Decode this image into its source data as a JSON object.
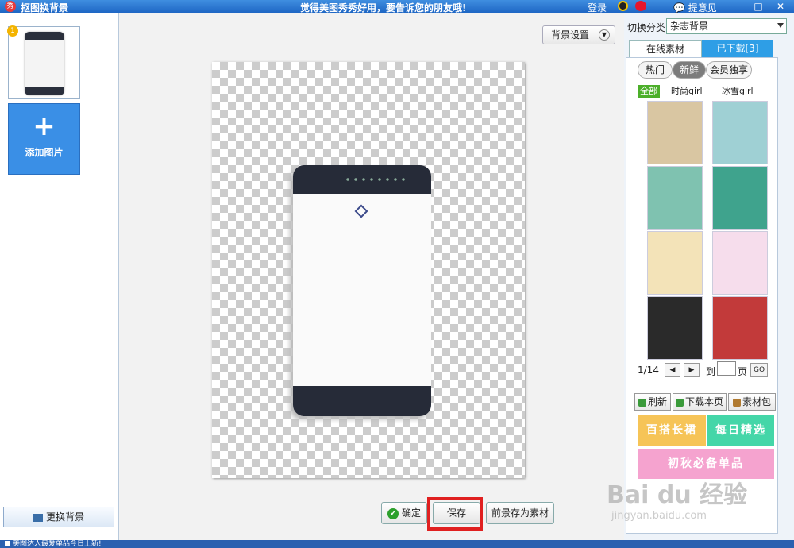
{
  "title_bar": {
    "app_logo": "秀",
    "app_title": "抠图换背景",
    "slogan": "觉得美图秀秀好用，要告诉您的朋友哦!",
    "login": "登录",
    "feedback": "提意见"
  },
  "left_panel": {
    "thumb_badge": "1",
    "add_image_label": "添加图片",
    "change_bg_label": "更换背景"
  },
  "canvas": {
    "bg_settings_label": "背景设置"
  },
  "actions": {
    "confirm_label": "确定",
    "save_label": "保存",
    "save_fg_label": "前景存为素材"
  },
  "right_panel": {
    "category_label": "切换分类",
    "category_value": "杂志背景",
    "tabs": [
      "在线素材",
      "已下载[3]"
    ],
    "pills": [
      "热门",
      "新鲜",
      "会员独享"
    ],
    "filters": [
      "全部",
      "时尚girl",
      "冰雪girl"
    ],
    "tiles": [
      {
        "name": "tile-1",
        "color": "#d9c6a2"
      },
      {
        "name": "tile-2",
        "color": "#9fd0d4"
      },
      {
        "name": "tile-3",
        "color": "#7fc2b0"
      },
      {
        "name": "tile-4",
        "color": "#3fa38d"
      },
      {
        "name": "tile-5",
        "color": "#f3e3b8"
      },
      {
        "name": "tile-6",
        "color": "#f6ddec"
      },
      {
        "name": "tile-7",
        "color": "#2a2a2a"
      },
      {
        "name": "tile-8",
        "color": "#c23a3a"
      }
    ],
    "pager": {
      "current": "1/14",
      "goto_label": "到",
      "page_label": "页",
      "go_label": "GO"
    },
    "buttons": {
      "refresh": "刷新",
      "download_page": "下载本页",
      "material_pack": "素材包"
    },
    "promos": {
      "promo1": "百搭长裙",
      "promo2": "每日精选",
      "promo3": "初秋必备单品"
    }
  },
  "status_bar": {
    "text": "美图达人最爱单品今日上新!"
  },
  "watermark": {
    "main": "Bai du 经验",
    "sub": "jingyan.baidu.com"
  },
  "colors": {
    "accent": "#2e9ee6",
    "highlight": "#e02020"
  }
}
